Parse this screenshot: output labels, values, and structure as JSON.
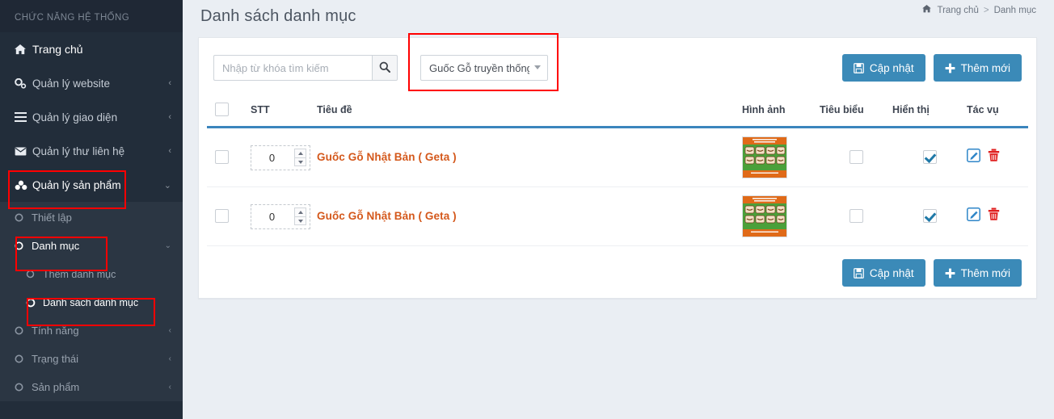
{
  "sidebar": {
    "heading": "CHỨC NĂNG HỆ THỐNG",
    "items": [
      {
        "label": "Trang chủ",
        "icon": "home-icon",
        "chevron": ""
      },
      {
        "label": "Quản lý website",
        "icon": "gears-icon",
        "chevron": "‹"
      },
      {
        "label": "Quản lý giao diện",
        "icon": "bars-icon",
        "chevron": "‹"
      },
      {
        "label": "Quản lý thư liên hệ",
        "icon": "envelope-icon",
        "chevron": "‹"
      },
      {
        "label": "Quản lý sản phẩm",
        "icon": "cubes-icon",
        "chevron": "⌄"
      }
    ],
    "submenu": [
      {
        "label": "Thiết lập",
        "icon": "circle-o-icon",
        "chevron": "",
        "level": 1
      },
      {
        "label": "Danh mục",
        "icon": "circle-o-icon",
        "chevron": "⌄",
        "level": 1
      },
      {
        "label": "Thêm danh mục",
        "icon": "circle-o-icon",
        "chevron": "",
        "level": 2
      },
      {
        "label": "Danh sách danh mục",
        "icon": "circle-o-icon",
        "chevron": "",
        "level": 2
      },
      {
        "label": "Tính năng",
        "icon": "circle-o-icon",
        "chevron": "‹",
        "level": 1
      },
      {
        "label": "Trạng thái",
        "icon": "circle-o-icon",
        "chevron": "‹",
        "level": 1
      },
      {
        "label": "Sản phẩm",
        "icon": "circle-o-icon",
        "chevron": "‹",
        "level": 1
      }
    ]
  },
  "header": {
    "title": "Danh sách danh mục",
    "breadcrumb": {
      "home": "Trang chủ",
      "separator": ">",
      "current": "Danh mục"
    }
  },
  "toolbar": {
    "search_placeholder": "Nhập từ khóa tìm kiếm",
    "search_value": "",
    "search_icon": "search-icon",
    "category_selected": "Guốc Gỗ truyền thống",
    "category_options": [
      "Guốc Gỗ truyền thống"
    ],
    "update_label": "Cập nhật",
    "add_label": "Thêm mới"
  },
  "table": {
    "columns": {
      "select": "",
      "stt": "STT",
      "title": "Tiêu đề",
      "image": "Hình ảnh",
      "featured": "Tiêu biểu",
      "visible": "Hiển thị",
      "actions": "Tác vụ"
    },
    "rows": [
      {
        "selected": false,
        "stt": "0",
        "title": "Guốc Gỗ Nhật Bản ( Geta )",
        "image_alt": "wooden-clogs-thumbnail",
        "featured": false,
        "visible": true,
        "edit_icon": "edit-icon",
        "delete_icon": "trash-icon"
      },
      {
        "selected": false,
        "stt": "0",
        "title": "Guốc Gỗ Nhật Bản ( Geta )",
        "image_alt": "wooden-clogs-thumbnail",
        "featured": false,
        "visible": true,
        "edit_icon": "edit-icon",
        "delete_icon": "trash-icon"
      }
    ]
  },
  "footer": {
    "update_label": "Cập nhật",
    "add_label": "Thêm mới"
  },
  "colors": {
    "sidebar_bg": "#222d3a",
    "submenu_bg": "#2b3643",
    "accent_blue": "#3b8ab8",
    "header_underline": "#3b85bd",
    "row_title": "#d4581b",
    "annotation_red": "#ff0000",
    "page_bg": "#eaeef3"
  }
}
